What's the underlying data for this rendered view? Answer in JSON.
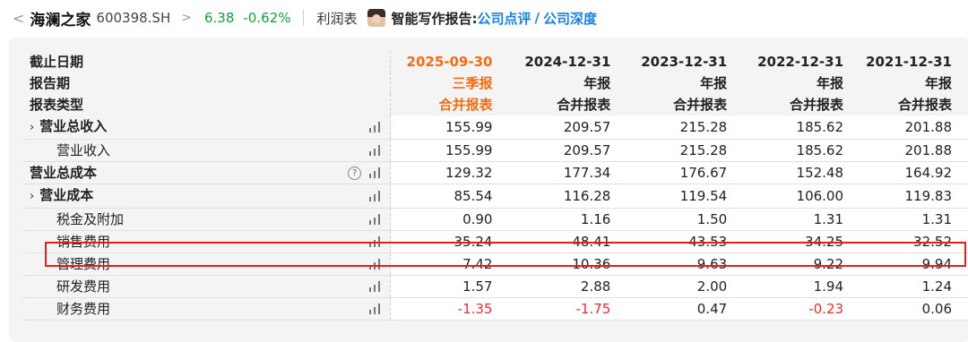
{
  "header": {
    "stock_name": "海澜之家",
    "stock_code": "600398.SH",
    "price": "6.38",
    "change": "-0.62%",
    "statement_link": "利润表",
    "ai_report_label": "智能写作报告:",
    "ai_link_1": "公司点评",
    "ai_link_sep": "/",
    "ai_link_2": "公司深度",
    "back_glyph": "<",
    "chevron_glyph": ">"
  },
  "table": {
    "header_rows": [
      {
        "label": "截止日期",
        "values": [
          "2025-09-30",
          "2024-12-31",
          "2023-12-31",
          "2022-12-31",
          "2021-12-31"
        ]
      },
      {
        "label": "报告期",
        "values": [
          "三季报",
          "年报",
          "年报",
          "年报",
          "年报"
        ]
      },
      {
        "label": "报表类型",
        "values": [
          "合并报表",
          "合并报表",
          "合并报表",
          "合并报表",
          "合并报表"
        ]
      }
    ],
    "rows": [
      {
        "label": "营业总收入",
        "expand": "›",
        "values": [
          "155.99",
          "209.57",
          "215.28",
          "185.62",
          "201.88"
        ]
      },
      {
        "label": "营业收入",
        "values": [
          "155.99",
          "209.57",
          "215.28",
          "185.62",
          "201.88"
        ]
      },
      {
        "label": "营业总成本",
        "help": "?",
        "values": [
          "129.32",
          "177.34",
          "176.67",
          "152.48",
          "164.92"
        ]
      },
      {
        "label": "营业成本",
        "expand": "›",
        "values": [
          "85.54",
          "116.28",
          "119.54",
          "106.00",
          "119.83"
        ]
      },
      {
        "label": "税金及附加",
        "values": [
          "0.90",
          "1.16",
          "1.50",
          "1.31",
          "1.31"
        ]
      },
      {
        "label": "销售费用",
        "values": [
          "35.24",
          "48.41",
          "43.53",
          "34.25",
          "32.52"
        ]
      },
      {
        "label": "管理费用",
        "values": [
          "7.42",
          "10.36",
          "9.63",
          "9.22",
          "9.94"
        ]
      },
      {
        "label": "研发费用",
        "values": [
          "1.57",
          "2.88",
          "2.00",
          "1.94",
          "1.24"
        ]
      },
      {
        "label": "财务费用",
        "values": [
          "-1.35",
          "-1.75",
          "0.47",
          "-0.23",
          "0.06"
        ]
      }
    ]
  },
  "colors": {
    "positive_green": "#13a03b",
    "negative_red": "#e03030",
    "latest_period_orange": "#f26c11",
    "link_blue": "#1a82d9",
    "highlight_red": "#e01e1e"
  },
  "icons": {
    "back": "chevron-left-icon",
    "breadcrumb": "chevron-right-icon",
    "chart": "bar-chart-icon",
    "help": "question-circle-icon",
    "expand": "expand-arrow-icon"
  }
}
